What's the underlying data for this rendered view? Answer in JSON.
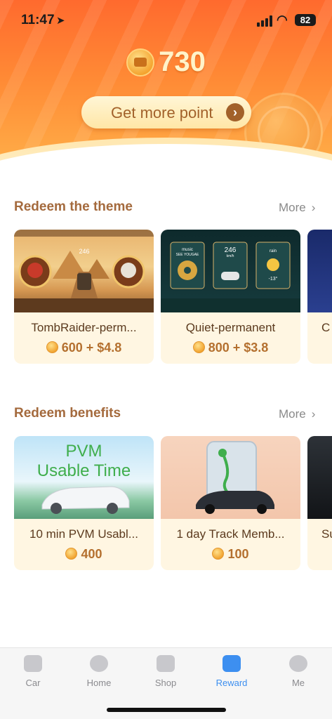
{
  "status_bar": {
    "time": "11:47",
    "battery": "82"
  },
  "header": {
    "points": "730",
    "get_more_label": "Get more point",
    "get_more_arrow": "›"
  },
  "sections": {
    "theme": {
      "title": "Redeem the theme",
      "more": "More",
      "items": [
        {
          "name": "TombRaider-perm...",
          "price": "600 + $4.8"
        },
        {
          "name": "Quiet-permanent",
          "price": "800 + $3.8"
        },
        {
          "name": "C"
        }
      ]
    },
    "benefits": {
      "title": "Redeem benefits",
      "more": "More",
      "items": [
        {
          "name": "10 min PVM Usabl...",
          "price": "400",
          "image_text_1": "PVM",
          "image_text_2": "Usable Time"
        },
        {
          "name": "1 day Track Memb...",
          "price": "100"
        },
        {
          "name": "Su"
        }
      ]
    }
  },
  "quiet_screen": {
    "music": "music",
    "music_sub": "SEE YOUGAE",
    "speed": "246",
    "speed_unit": "km/h",
    "weather": "rain",
    "temp": "-13°"
  },
  "tomb_screen": {
    "speed": "246"
  },
  "tab_bar": {
    "tabs": [
      {
        "label": "Car",
        "icon": "car-icon"
      },
      {
        "label": "Home",
        "icon": "planet-icon"
      },
      {
        "label": "Shop",
        "icon": "bag-icon"
      },
      {
        "label": "Reward",
        "icon": "gift-icon"
      },
      {
        "label": "Me",
        "icon": "avatar-icon"
      }
    ],
    "active": "Reward"
  },
  "colors": {
    "accent": "#3d8ff0",
    "hero_top": "#ff6a2e",
    "section_title": "#a46a3d"
  }
}
